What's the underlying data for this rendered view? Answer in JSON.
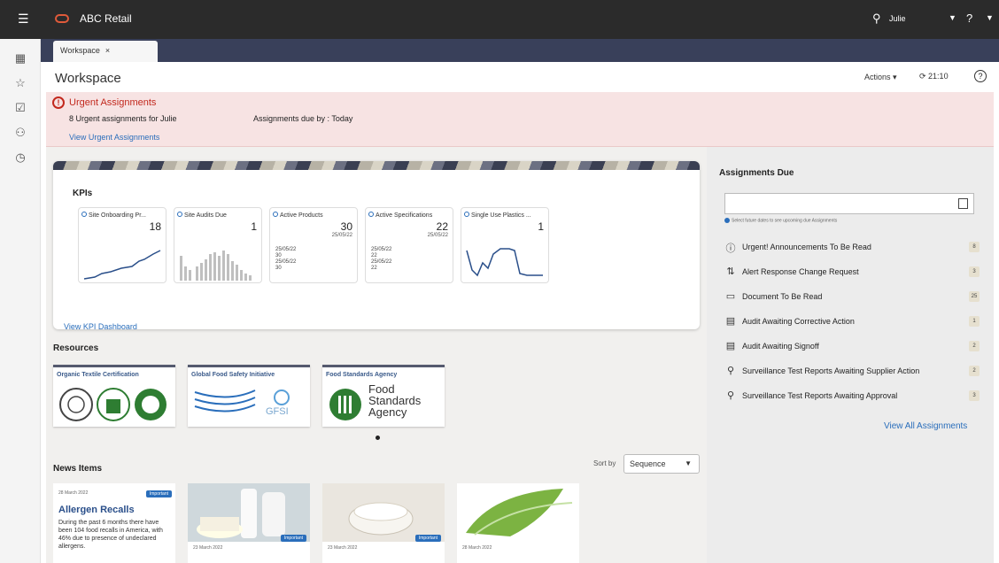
{
  "topbar": {
    "menu_icon": "hamburger-icon",
    "app_title": "ABC Retail",
    "user_icon": "user-icon",
    "user_name": "Julie",
    "help_icon": "help-icon"
  },
  "leftrail": {
    "icons": [
      "grid-icon",
      "star-icon",
      "calendar-check-icon",
      "people-icon",
      "clock-icon"
    ]
  },
  "tabs": [
    {
      "label": "Workspace",
      "close": "×"
    }
  ],
  "header": {
    "title": "Workspace",
    "actions_label": "Actions",
    "refresh_time": "21:10"
  },
  "urgent": {
    "title": "Urgent Assignments",
    "count_text": "8 Urgent assignments for Julie",
    "due_text": "Assignments due by : Today",
    "link": "View Urgent Assignments"
  },
  "kpis": {
    "title": "KPIs",
    "link": "View KPI Dashboard",
    "tiles": [
      {
        "name": "Site Onboarding Pr...",
        "value": "18",
        "date": "",
        "rows": []
      },
      {
        "name": "Site Audits Due",
        "value": "1",
        "date": "",
        "rows": []
      },
      {
        "name": "Active Products",
        "value": "30",
        "date": "25/05/22",
        "rows": [
          "25/05/22",
          "30",
          "25/05/22",
          "30"
        ]
      },
      {
        "name": "Active Specifications",
        "value": "22",
        "date": "25/05/22",
        "rows": [
          "25/05/22",
          "22",
          "25/05/22",
          "22"
        ]
      },
      {
        "name": "Single Use Plastics ...",
        "value": "1",
        "date": "",
        "rows": []
      }
    ]
  },
  "resources": {
    "title": "Resources",
    "cards": [
      {
        "title": "Organic Textile Certification"
      },
      {
        "title": "Global Food Safety Initiative",
        "logo_text": "GFSI"
      },
      {
        "title": "Food Standards Agency",
        "logo_line1": "Food",
        "logo_line2": "Standards",
        "logo_line3": "Agency"
      }
    ]
  },
  "news": {
    "title": "News Items",
    "sort_label": "Sort by",
    "sort_value": "Sequence",
    "cards": [
      {
        "date": "28 March 2022",
        "badge": "Important",
        "headline": "Allergen Recalls",
        "body": "During the past 6 months there have been 104 food recalls in America, with 46% due to presence of undeclared allergens."
      },
      {
        "date": "23 March 2022",
        "badge": "Important"
      },
      {
        "date": "23 March 2022",
        "badge": "Important"
      },
      {
        "date": "28 March 2022",
        "badge": ""
      }
    ]
  },
  "assignments": {
    "title": "Assignments Due",
    "hint": "Select future dates to see upcoming due Assignments",
    "items": [
      {
        "icon": "alert-circle-icon",
        "label": "Urgent! Announcements To Be Read",
        "count": "8"
      },
      {
        "icon": "workflow-icon",
        "label": "Alert Response Change Request",
        "count": "3"
      },
      {
        "icon": "document-icon",
        "label": "Document To Be Read",
        "count": "25"
      },
      {
        "icon": "clipboard-icon",
        "label": "Audit Awaiting Corrective Action",
        "count": "1"
      },
      {
        "icon": "clipboard-icon",
        "label": "Audit Awaiting Signoff",
        "count": "2"
      },
      {
        "icon": "search-test-icon",
        "label": "Surveillance Test Reports Awaiting Supplier Action",
        "count": "2"
      },
      {
        "icon": "search-test-icon",
        "label": "Surveillance Test Reports Awaiting Approval",
        "count": "3"
      }
    ],
    "view_all": "View All Assignments"
  },
  "colors": {
    "topbar": "#2b2b2b",
    "tabbar": "#39405a",
    "urgent_bg": "#f7e3e3",
    "urgent_text": "#c2281d",
    "link": "#2a6ebb"
  }
}
